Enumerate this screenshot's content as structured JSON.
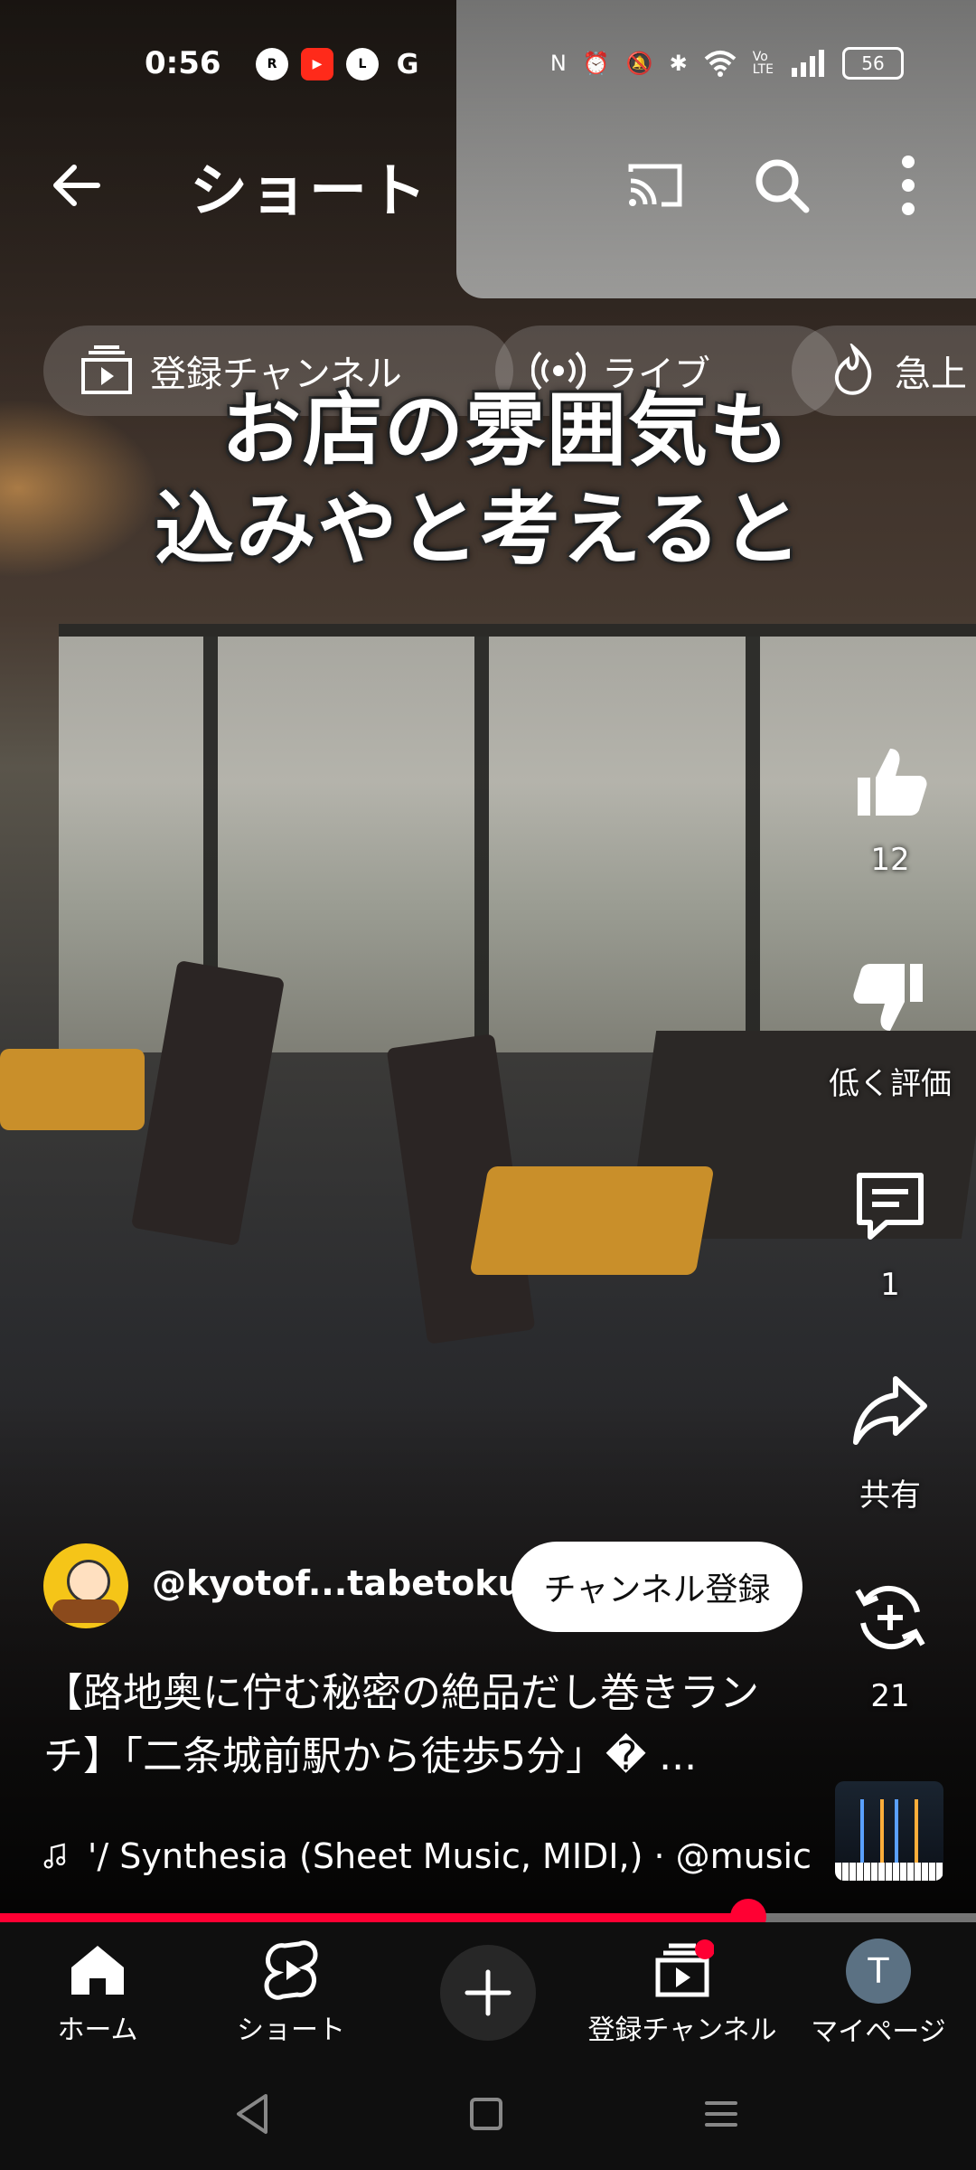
{
  "status_bar": {
    "time": "0:56",
    "battery": "56",
    "left_icons": [
      "rakuten-link-icon",
      "youtube-icon",
      "line-icon",
      "google-icon"
    ],
    "right_icons": [
      "nfc-icon",
      "alarm-icon",
      "mute-icon",
      "bluetooth-icon",
      "wifi-icon",
      "volte-icon",
      "signal-icon",
      "battery-icon"
    ]
  },
  "header": {
    "title": "ショート",
    "icons": [
      "back-arrow-icon",
      "cast-icon",
      "search-icon",
      "more-vert-icon"
    ]
  },
  "chips": [
    {
      "label": "登録チャンネル",
      "icon": "subscriptions-icon"
    },
    {
      "label": "ライブ",
      "icon": "live-icon"
    },
    {
      "label": "急上",
      "icon": "trending-icon"
    }
  ],
  "overlay_text": {
    "line1": "お店の雰囲気も",
    "line2": "込みやと考えると"
  },
  "actions": {
    "like_count": "12",
    "dislike_label": "低く評価",
    "comment_count": "1",
    "share_label": "共有",
    "remix_count": "21"
  },
  "channel": {
    "handle": "@kyotof...tabetoku",
    "subscribe_label": "チャンネル登録"
  },
  "video": {
    "title": "【路地奥に佇む秘密の絶品だし巻きランチ】「二条城前駅から徒歩5分」� ...",
    "sound": "'/ Synthesia (Sheet Music, MIDI,) · @music"
  },
  "progress": {
    "fraction": 0.767
  },
  "bottom_nav": {
    "home": "ホーム",
    "shorts": "ショート",
    "subscriptions": "登録チャンネル",
    "me": "マイページ",
    "avatar_letter": "T"
  },
  "colors": {
    "accent": "#ff0033",
    "nav_bg": "#0f0f0f",
    "avatar_bg": "#5b7183"
  }
}
